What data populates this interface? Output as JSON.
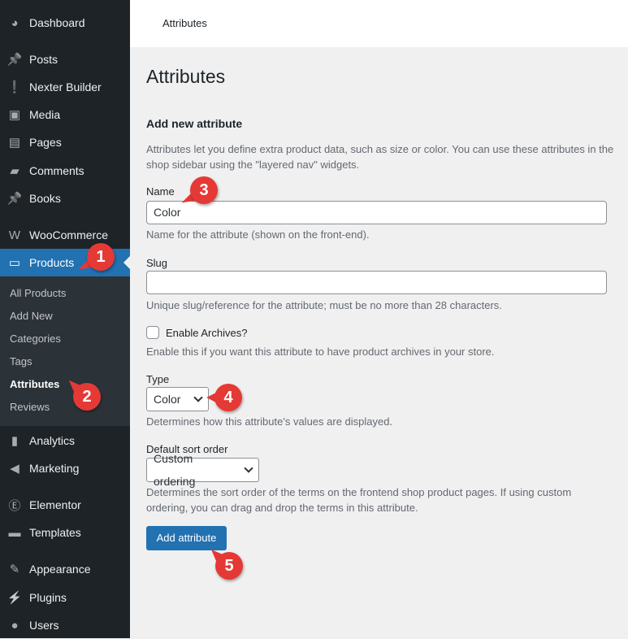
{
  "sidebar": {
    "items": [
      {
        "label": "Dashboard",
        "icon": "dashboard-icon"
      },
      {
        "label": "Posts",
        "icon": "pin-icon"
      },
      {
        "label": "Nexter Builder",
        "icon": "exclamation-icon"
      },
      {
        "label": "Media",
        "icon": "media-icon"
      },
      {
        "label": "Pages",
        "icon": "pages-icon"
      },
      {
        "label": "Comments",
        "icon": "comment-icon"
      },
      {
        "label": "Books",
        "icon": "pin-icon"
      },
      {
        "label": "WooCommerce",
        "icon": "woo-icon"
      },
      {
        "label": "Products",
        "icon": "archive-icon"
      },
      {
        "label": "Analytics",
        "icon": "bar-chart-icon"
      },
      {
        "label": "Marketing",
        "icon": "megaphone-icon"
      },
      {
        "label": "Elementor",
        "icon": "elementor-icon"
      },
      {
        "label": "Templates",
        "icon": "folder-icon"
      },
      {
        "label": "Appearance",
        "icon": "brush-icon"
      },
      {
        "label": "Plugins",
        "icon": "plugin-icon"
      },
      {
        "label": "Users",
        "icon": "user-icon"
      }
    ],
    "submenu": [
      "All Products",
      "Add New",
      "Categories",
      "Tags",
      "Attributes",
      "Reviews"
    ]
  },
  "header": {
    "title": "Attributes"
  },
  "main": {
    "title": "Attributes",
    "section": "Add new attribute",
    "intro1": "Attributes let you define extra product data, such as size or color. You can use these attributes in the",
    "intro2": "shop sidebar using the \"layered nav\" widgets.",
    "name_label": "Name",
    "name_value": "Color",
    "name_desc": "Name for the attribute (shown on the front-end).",
    "slug_label": "Slug",
    "slug_value": "",
    "slug_desc": "Unique slug/reference for the attribute; must be no more than 28 characters.",
    "archives_label": "Enable Archives?",
    "archives_checked": false,
    "archives_desc": "Enable this if you want this attribute to have product archives in your store.",
    "type_label": "Type",
    "type_value": "Color",
    "type_desc": "Determines how this attribute's values are displayed.",
    "sort_label": "Default sort order",
    "sort_value": "Custom ordering",
    "sort_desc1": "Determines the sort order of the terms on the frontend shop product pages. If using custom",
    "sort_desc2": "ordering, you can drag and drop the terms in this attribute.",
    "submit": "Add attribute"
  },
  "callouts": [
    "1",
    "2",
    "3",
    "4",
    "5"
  ],
  "colors": {
    "sidebar": "#1d2327",
    "accent": "#2271b1",
    "callout": "#e53935"
  }
}
